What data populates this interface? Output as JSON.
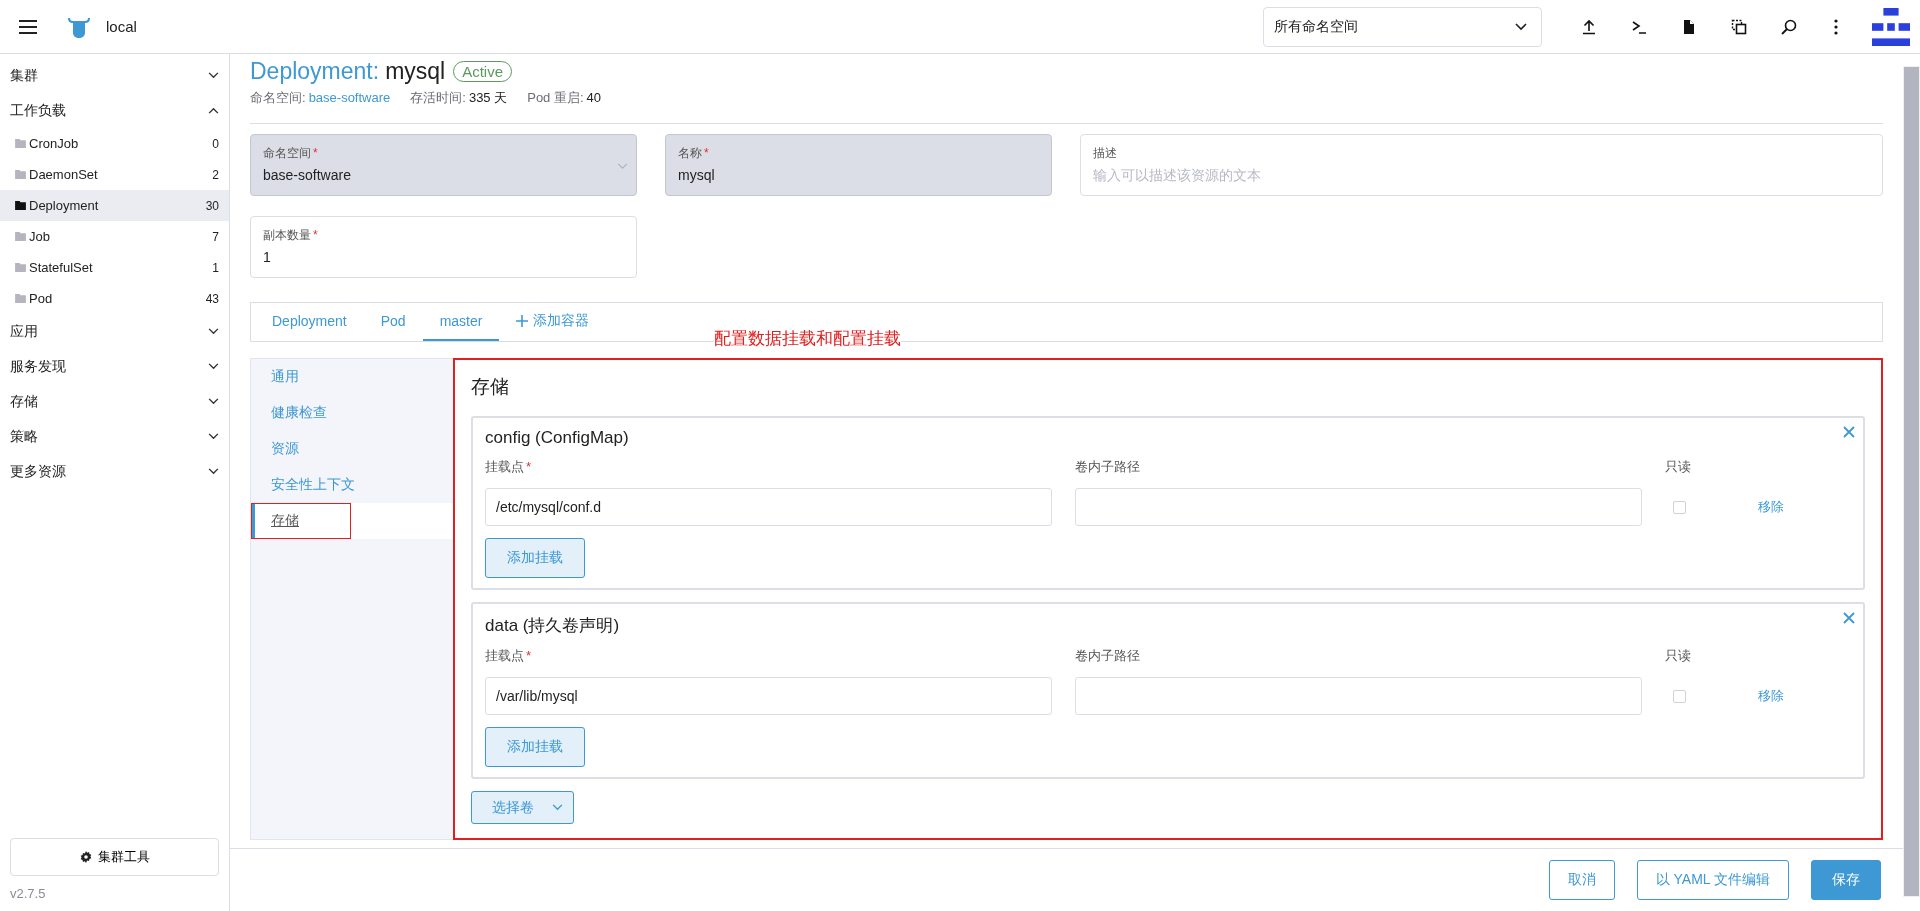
{
  "header": {
    "cluster": "local",
    "namespace_select": "所有命名空间"
  },
  "sidebar": {
    "groups": [
      {
        "label": "集群",
        "expanded": false
      },
      {
        "label": "工作负载",
        "expanded": true,
        "children": [
          {
            "label": "CronJob",
            "count": "0",
            "selected": false
          },
          {
            "label": "DaemonSet",
            "count": "2",
            "selected": false
          },
          {
            "label": "Deployment",
            "count": "30",
            "selected": true
          },
          {
            "label": "Job",
            "count": "7",
            "selected": false
          },
          {
            "label": "StatefulSet",
            "count": "1",
            "selected": false
          },
          {
            "label": "Pod",
            "count": "43",
            "selected": false
          }
        ]
      },
      {
        "label": "应用",
        "expanded": false
      },
      {
        "label": "服务发现",
        "expanded": false
      },
      {
        "label": "存储",
        "expanded": false
      },
      {
        "label": "策略",
        "expanded": false
      },
      {
        "label": "更多资源",
        "expanded": false
      }
    ],
    "tools_button": "集群工具",
    "version": "v2.7.5"
  },
  "page": {
    "kind": "Deployment:",
    "name": "mysql",
    "status": "Active",
    "meta": [
      {
        "label": "命名空间:",
        "value": "base-software",
        "link": true
      },
      {
        "label": "存活时间:",
        "value": "335 天",
        "link": false
      },
      {
        "label": "Pod 重启:",
        "value": "40",
        "link": false
      }
    ]
  },
  "form": {
    "fields": [
      {
        "kind": "select",
        "label": "命名空间",
        "required_mark": "*",
        "value": "base-software",
        "disabled": true
      },
      {
        "kind": "text",
        "label": "名称",
        "required_mark": "*",
        "value": "mysql",
        "disabled": true
      },
      {
        "kind": "text",
        "label": "描述",
        "placeholder": "输入可以描述该资源的文本",
        "disabled": false
      }
    ],
    "replicas": {
      "label": "副本数量",
      "required_mark": "*",
      "value": "1"
    }
  },
  "tabs": [
    {
      "kind": "tab",
      "label": "Deployment",
      "selected": false
    },
    {
      "kind": "tab",
      "label": "Pod",
      "selected": false
    },
    {
      "kind": "tab",
      "label": "master",
      "selected": true
    },
    {
      "kind": "add",
      "label": "添加容器",
      "selected": false
    }
  ],
  "annotation": "配置数据挂载和配置挂载",
  "subnav": [
    {
      "label": "通用",
      "selected": false,
      "annotated": false
    },
    {
      "label": "健康检查",
      "selected": false,
      "annotated": false
    },
    {
      "label": "资源",
      "selected": false,
      "annotated": false
    },
    {
      "label": "安全性上下文",
      "selected": false,
      "annotated": false
    },
    {
      "label": "存储",
      "selected": true,
      "annotated": true
    }
  ],
  "storage": {
    "title": "存储",
    "annotated": true,
    "volumes": [
      {
        "title": "config (ConfigMap)",
        "mount_label": "挂载点",
        "mount_required_mark": "*",
        "mount_path": "/etc/mysql/conf.d",
        "subpath_label": "卷内子路径",
        "readonly_label": "只读",
        "readonly": false,
        "remove": "移除",
        "add_button": "添加挂载"
      },
      {
        "title": "data (持久卷声明)",
        "mount_label": "挂载点",
        "mount_required_mark": "*",
        "mount_path": "/var/lib/mysql",
        "subpath_label": "卷内子路径",
        "readonly_label": "只读",
        "readonly": false,
        "remove": "移除",
        "add_button": "添加挂载"
      }
    ],
    "select_button": "选择卷"
  },
  "footer": {
    "buttons": [
      {
        "label": "取消",
        "kind": "secondary"
      },
      {
        "label": "以 YAML 文件编辑",
        "kind": "secondary"
      },
      {
        "label": "保存",
        "kind": "primary"
      }
    ]
  }
}
